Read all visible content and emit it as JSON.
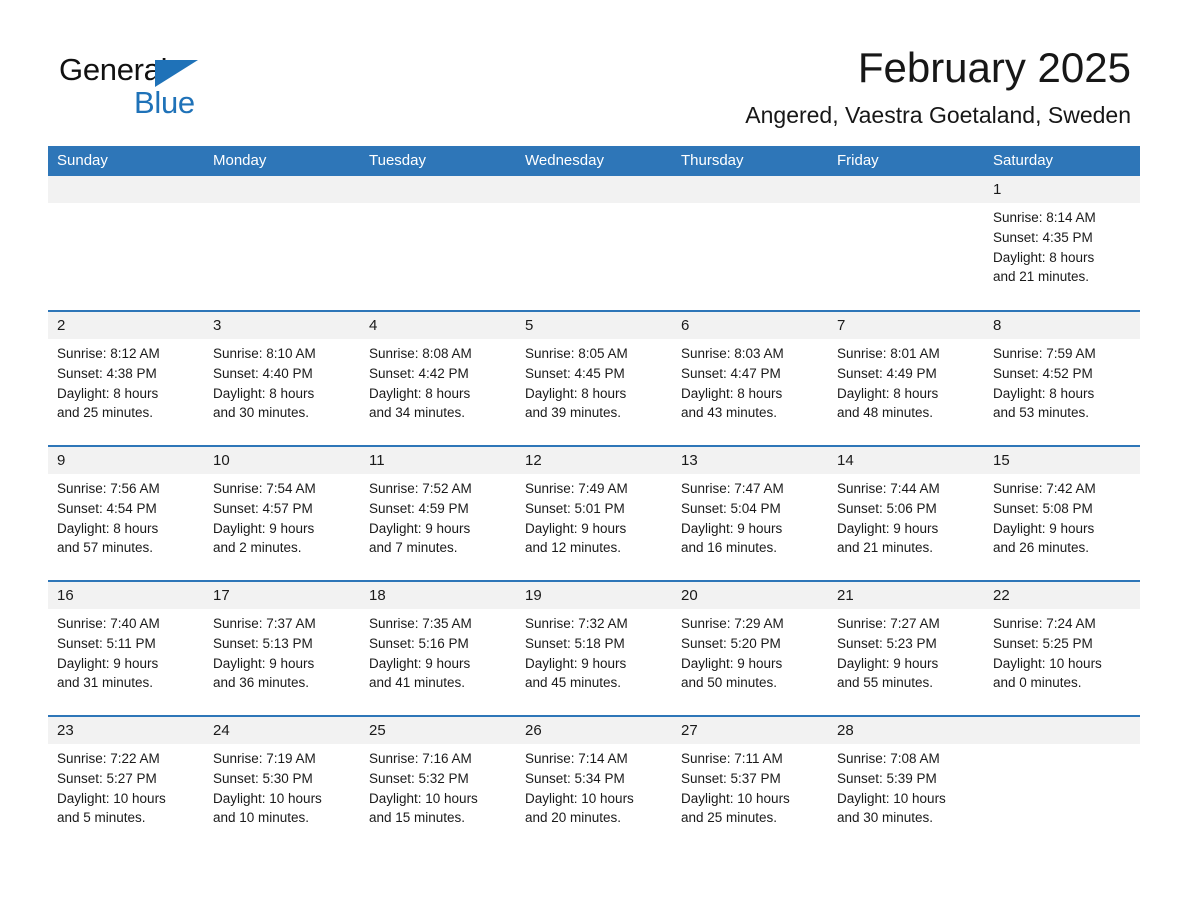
{
  "brand": {
    "name_part1": "General",
    "name_part2": "Blue",
    "triangle_color": "#1F72B8"
  },
  "header": {
    "title": "February 2025",
    "subtitle": "Angered, Vaestra Goetaland, Sweden"
  },
  "theme": {
    "header_blue": "#2E76B8",
    "day_band_gray": "#F2F2F2",
    "text": "#1a1a1a"
  },
  "calendar": {
    "day_headers": [
      "Sunday",
      "Monday",
      "Tuesday",
      "Wednesday",
      "Thursday",
      "Friday",
      "Saturday"
    ],
    "weeks": [
      [
        {
          "day": "",
          "lines": []
        },
        {
          "day": "",
          "lines": []
        },
        {
          "day": "",
          "lines": []
        },
        {
          "day": "",
          "lines": []
        },
        {
          "day": "",
          "lines": []
        },
        {
          "day": "",
          "lines": []
        },
        {
          "day": "1",
          "lines": [
            "Sunrise: 8:14 AM",
            "Sunset: 4:35 PM",
            "Daylight: 8 hours",
            "and 21 minutes."
          ]
        }
      ],
      [
        {
          "day": "2",
          "lines": [
            "Sunrise: 8:12 AM",
            "Sunset: 4:38 PM",
            "Daylight: 8 hours",
            "and 25 minutes."
          ]
        },
        {
          "day": "3",
          "lines": [
            "Sunrise: 8:10 AM",
            "Sunset: 4:40 PM",
            "Daylight: 8 hours",
            "and 30 minutes."
          ]
        },
        {
          "day": "4",
          "lines": [
            "Sunrise: 8:08 AM",
            "Sunset: 4:42 PM",
            "Daylight: 8 hours",
            "and 34 minutes."
          ]
        },
        {
          "day": "5",
          "lines": [
            "Sunrise: 8:05 AM",
            "Sunset: 4:45 PM",
            "Daylight: 8 hours",
            "and 39 minutes."
          ]
        },
        {
          "day": "6",
          "lines": [
            "Sunrise: 8:03 AM",
            "Sunset: 4:47 PM",
            "Daylight: 8 hours",
            "and 43 minutes."
          ]
        },
        {
          "day": "7",
          "lines": [
            "Sunrise: 8:01 AM",
            "Sunset: 4:49 PM",
            "Daylight: 8 hours",
            "and 48 minutes."
          ]
        },
        {
          "day": "8",
          "lines": [
            "Sunrise: 7:59 AM",
            "Sunset: 4:52 PM",
            "Daylight: 8 hours",
            "and 53 minutes."
          ]
        }
      ],
      [
        {
          "day": "9",
          "lines": [
            "Sunrise: 7:56 AM",
            "Sunset: 4:54 PM",
            "Daylight: 8 hours",
            "and 57 minutes."
          ]
        },
        {
          "day": "10",
          "lines": [
            "Sunrise: 7:54 AM",
            "Sunset: 4:57 PM",
            "Daylight: 9 hours",
            "and 2 minutes."
          ]
        },
        {
          "day": "11",
          "lines": [
            "Sunrise: 7:52 AM",
            "Sunset: 4:59 PM",
            "Daylight: 9 hours",
            "and 7 minutes."
          ]
        },
        {
          "day": "12",
          "lines": [
            "Sunrise: 7:49 AM",
            "Sunset: 5:01 PM",
            "Daylight: 9 hours",
            "and 12 minutes."
          ]
        },
        {
          "day": "13",
          "lines": [
            "Sunrise: 7:47 AM",
            "Sunset: 5:04 PM",
            "Daylight: 9 hours",
            "and 16 minutes."
          ]
        },
        {
          "day": "14",
          "lines": [
            "Sunrise: 7:44 AM",
            "Sunset: 5:06 PM",
            "Daylight: 9 hours",
            "and 21 minutes."
          ]
        },
        {
          "day": "15",
          "lines": [
            "Sunrise: 7:42 AM",
            "Sunset: 5:08 PM",
            "Daylight: 9 hours",
            "and 26 minutes."
          ]
        }
      ],
      [
        {
          "day": "16",
          "lines": [
            "Sunrise: 7:40 AM",
            "Sunset: 5:11 PM",
            "Daylight: 9 hours",
            "and 31 minutes."
          ]
        },
        {
          "day": "17",
          "lines": [
            "Sunrise: 7:37 AM",
            "Sunset: 5:13 PM",
            "Daylight: 9 hours",
            "and 36 minutes."
          ]
        },
        {
          "day": "18",
          "lines": [
            "Sunrise: 7:35 AM",
            "Sunset: 5:16 PM",
            "Daylight: 9 hours",
            "and 41 minutes."
          ]
        },
        {
          "day": "19",
          "lines": [
            "Sunrise: 7:32 AM",
            "Sunset: 5:18 PM",
            "Daylight: 9 hours",
            "and 45 minutes."
          ]
        },
        {
          "day": "20",
          "lines": [
            "Sunrise: 7:29 AM",
            "Sunset: 5:20 PM",
            "Daylight: 9 hours",
            "and 50 minutes."
          ]
        },
        {
          "day": "21",
          "lines": [
            "Sunrise: 7:27 AM",
            "Sunset: 5:23 PM",
            "Daylight: 9 hours",
            "and 55 minutes."
          ]
        },
        {
          "day": "22",
          "lines": [
            "Sunrise: 7:24 AM",
            "Sunset: 5:25 PM",
            "Daylight: 10 hours",
            "and 0 minutes."
          ]
        }
      ],
      [
        {
          "day": "23",
          "lines": [
            "Sunrise: 7:22 AM",
            "Sunset: 5:27 PM",
            "Daylight: 10 hours",
            "and 5 minutes."
          ]
        },
        {
          "day": "24",
          "lines": [
            "Sunrise: 7:19 AM",
            "Sunset: 5:30 PM",
            "Daylight: 10 hours",
            "and 10 minutes."
          ]
        },
        {
          "day": "25",
          "lines": [
            "Sunrise: 7:16 AM",
            "Sunset: 5:32 PM",
            "Daylight: 10 hours",
            "and 15 minutes."
          ]
        },
        {
          "day": "26",
          "lines": [
            "Sunrise: 7:14 AM",
            "Sunset: 5:34 PM",
            "Daylight: 10 hours",
            "and 20 minutes."
          ]
        },
        {
          "day": "27",
          "lines": [
            "Sunrise: 7:11 AM",
            "Sunset: 5:37 PM",
            "Daylight: 10 hours",
            "and 25 minutes."
          ]
        },
        {
          "day": "28",
          "lines": [
            "Sunrise: 7:08 AM",
            "Sunset: 5:39 PM",
            "Daylight: 10 hours",
            "and 30 minutes."
          ]
        },
        {
          "day": "",
          "lines": []
        }
      ]
    ]
  }
}
